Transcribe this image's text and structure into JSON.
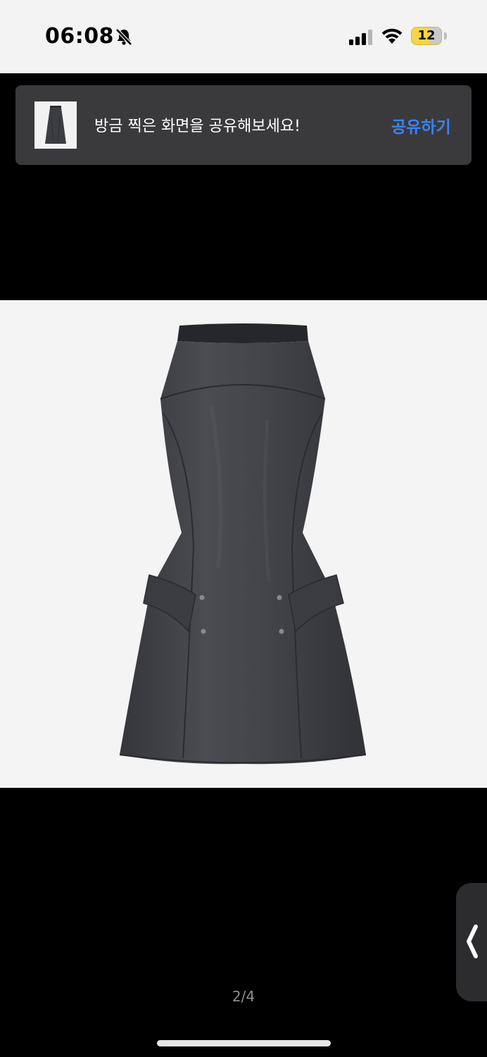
{
  "status_bar": {
    "time": "06:08",
    "battery_level": "12",
    "icons": [
      "bell-slash-icon",
      "cellular-signal-icon",
      "wifi-icon",
      "battery-icon"
    ]
  },
  "share_toast": {
    "message": "방금 찍은 화면을 공유해보세요!",
    "action_label": "공유하기",
    "action_color": "#3b82f6"
  },
  "viewer": {
    "page_indicator": "2/4",
    "side_handle_icon": "chevron-left-icon"
  },
  "colors": {
    "background": "#000000",
    "toast_background": "#3a3a3c",
    "status_bar_background": "#f3f3f3"
  }
}
